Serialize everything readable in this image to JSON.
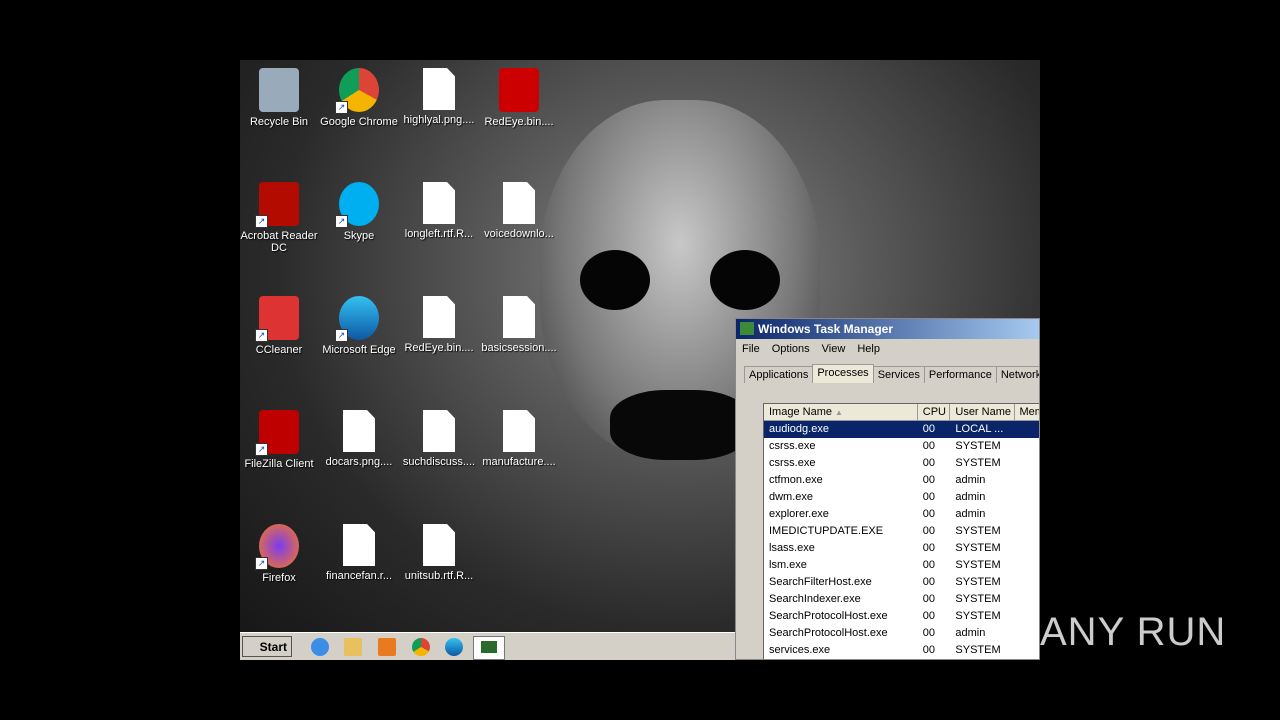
{
  "desktop": {
    "icons": [
      {
        "label": "Recycle Bin",
        "kind": "bin",
        "shortcut": false
      },
      {
        "label": "Google Chrome",
        "kind": "chrome",
        "shortcut": true
      },
      {
        "label": "highlyal.png....",
        "kind": "doc",
        "shortcut": false
      },
      {
        "label": "RedEye.bin....",
        "kind": "redeye",
        "shortcut": false
      },
      {
        "label": "Acrobat Reader DC",
        "kind": "acrobat",
        "shortcut": true
      },
      {
        "label": "Skype",
        "kind": "skype",
        "shortcut": true
      },
      {
        "label": "longleft.rtf.R...",
        "kind": "doc",
        "shortcut": false
      },
      {
        "label": "voicedownlo...",
        "kind": "doc",
        "shortcut": false
      },
      {
        "label": "CCleaner",
        "kind": "ccleaner",
        "shortcut": true
      },
      {
        "label": "Microsoft Edge",
        "kind": "edge",
        "shortcut": true
      },
      {
        "label": "RedEye.bin....",
        "kind": "doc",
        "shortcut": false
      },
      {
        "label": "basicsession....",
        "kind": "doc",
        "shortcut": false
      },
      {
        "label": "FileZilla Client",
        "kind": "filezilla",
        "shortcut": true
      },
      {
        "label": "docars.png....",
        "kind": "doc",
        "shortcut": false
      },
      {
        "label": "suchdiscuss....",
        "kind": "doc",
        "shortcut": false
      },
      {
        "label": "manufacture....",
        "kind": "doc",
        "shortcut": false
      },
      {
        "label": "Firefox",
        "kind": "firefox",
        "shortcut": true
      },
      {
        "label": "financefan.r...",
        "kind": "doc",
        "shortcut": false
      },
      {
        "label": "unitsub.rtf.R...",
        "kind": "doc",
        "shortcut": false
      }
    ]
  },
  "taskbar": {
    "start": "Start"
  },
  "task_manager": {
    "title": "Windows Task Manager",
    "menu": [
      "File",
      "Options",
      "View",
      "Help"
    ],
    "tabs": [
      "Applications",
      "Processes",
      "Services",
      "Performance",
      "Networking"
    ],
    "columns": [
      "Image Name",
      "CPU",
      "User Name",
      "Mem"
    ],
    "rows": [
      [
        "audiodg.exe",
        "00",
        "LOCAL ...",
        ""
      ],
      [
        "csrss.exe",
        "00",
        "SYSTEM",
        ""
      ],
      [
        "csrss.exe",
        "00",
        "SYSTEM",
        ""
      ],
      [
        "ctfmon.exe",
        "00",
        "admin",
        ""
      ],
      [
        "dwm.exe",
        "00",
        "admin",
        ""
      ],
      [
        "explorer.exe",
        "00",
        "admin",
        ""
      ],
      [
        "IMEDICTUPDATE.EXE",
        "00",
        "SYSTEM",
        ""
      ],
      [
        "lsass.exe",
        "00",
        "SYSTEM",
        ""
      ],
      [
        "lsm.exe",
        "00",
        "SYSTEM",
        ""
      ],
      [
        "SearchFilterHost.exe",
        "00",
        "SYSTEM",
        ""
      ],
      [
        "SearchIndexer.exe",
        "00",
        "SYSTEM",
        ""
      ],
      [
        "SearchProtocolHost.exe",
        "00",
        "SYSTEM",
        ""
      ],
      [
        "SearchProtocolHost.exe",
        "00",
        "admin",
        ""
      ],
      [
        "services.exe",
        "00",
        "SYSTEM",
        ""
      ]
    ]
  },
  "watermark": "ANY RUN"
}
